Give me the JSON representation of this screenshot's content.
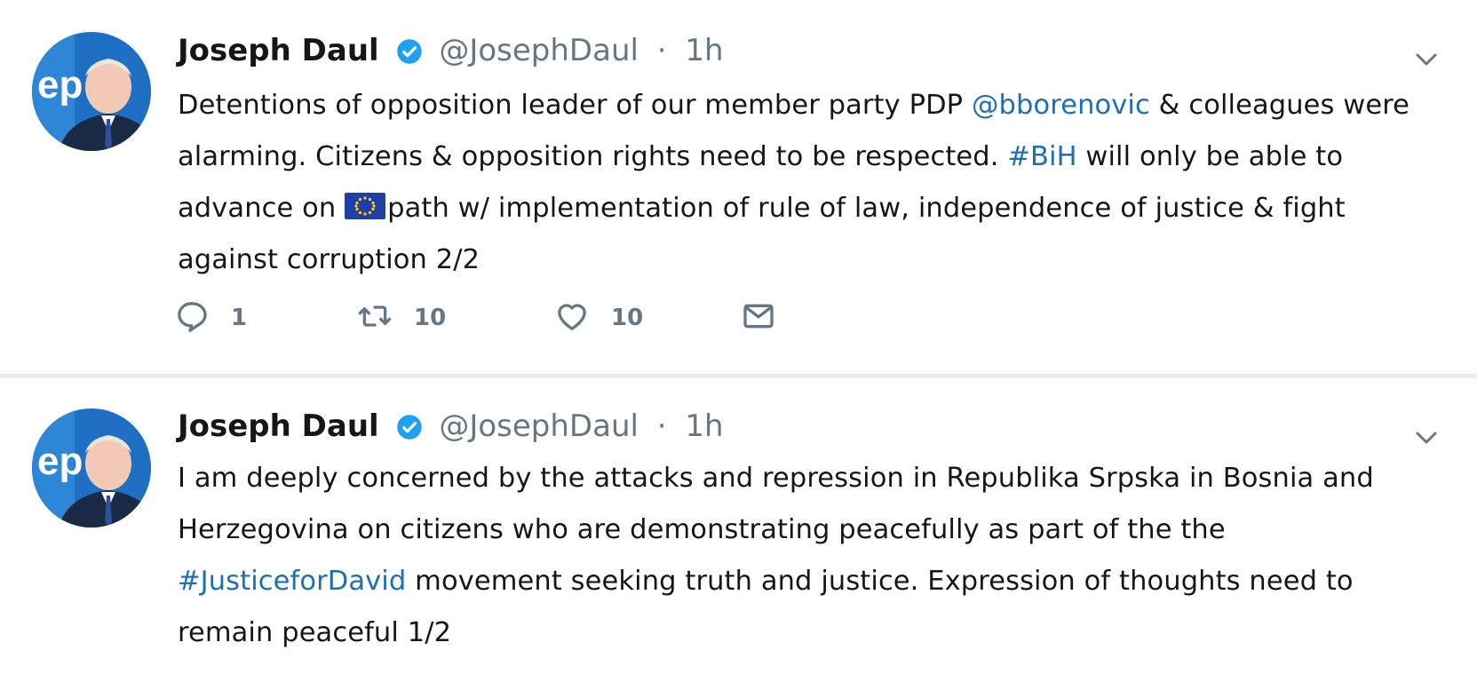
{
  "tweets": [
    {
      "name": "Joseph Daul",
      "handle": "@JosephDaul",
      "separator": "·",
      "time": "1h",
      "text_parts": [
        {
          "text": "Detentions of opposition leader of our member party PDP ",
          "link": false
        },
        {
          "text": "@bborenovic",
          "link": true
        },
        {
          "text": " & colleagues were alarming. Citizens & opposition rights need to be respected. ",
          "link": false
        },
        {
          "text": "#BiH",
          "link": true
        },
        {
          "text": " will only be able to advance on ",
          "link": false
        },
        {
          "emoji": "eu-flag"
        },
        {
          "text": "path w/ implementation of rule of law, independence of justice & fight against corruption 2/2",
          "link": false
        }
      ],
      "actions": {
        "reply_count": "1",
        "retweet_count": "10",
        "like_count": "10"
      }
    },
    {
      "name": "Joseph Daul",
      "handle": "@JosephDaul",
      "separator": "·",
      "time": "1h",
      "text_parts": [
        {
          "text": "I am deeply concerned by the attacks and repression in Republika Srpska in Bosnia and Herzegovina on citizens who are demonstrating peacefully as part of the the ",
          "link": false
        },
        {
          "text": "#JusticeforDavid",
          "link": true
        },
        {
          "text": " movement seeking truth and justice. Expression of thoughts need to remain peaceful 1/2",
          "link": false
        }
      ]
    }
  ],
  "colors": {
    "link": "#1b6fb6",
    "verified": "#1da1f2",
    "muted": "#657786",
    "divider": "#e6ecf0"
  },
  "icons": [
    "verified-badge-icon",
    "chevron-down-icon",
    "reply-icon",
    "retweet-icon",
    "like-icon",
    "direct-message-icon",
    "eu-flag-emoji"
  ]
}
